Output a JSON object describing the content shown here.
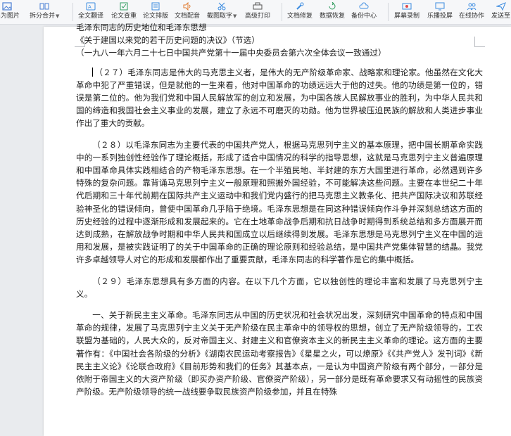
{
  "toolbar": {
    "items": [
      {
        "label": "出为图片"
      },
      {
        "label": "拆分合并"
      },
      {
        "label": "全文翻译"
      },
      {
        "label": "论文查重"
      },
      {
        "label": "论文排版"
      },
      {
        "label": "文档配音"
      },
      {
        "label": "截图取字"
      },
      {
        "label": "高级打印"
      },
      {
        "label": "文档修复"
      },
      {
        "label": "数据恢复"
      },
      {
        "label": "备份中心"
      },
      {
        "label": "屏幕录制"
      },
      {
        "label": "乐播投屏"
      },
      {
        "label": "在线协作"
      },
      {
        "label": "发送至"
      }
    ]
  },
  "document": {
    "title_line1": "毛泽东同志的历史地位和毛泽东思想",
    "title_line2": "《关于建国以来党的若干历史问题的决议》（节选）",
    "title_line3": "（一九八一年六月二十七日中国共产党第十一届中央委员会第六次全体会议一致通过）",
    "para27": "（２７）毛泽东同志是伟大的马克思主义者，是伟大的无产阶级革命家、战略家和理论家。他虽然在文化大革命中犯了严重错误，但是就他的一生来看，他对中国革命的功绩远远大于他的过失。他的功绩是第一位的，错误是第二位的。他为我们党和中国人民解放军的创立和发展，为中国各族人民解放事业的胜利，为中华人民共和国的缔造和我国社会主义事业的发展，建立了永远不可磨灭的功勋。他为世界被压迫民族的解放和人类进步事业作出了重大的贡献。",
    "para28": "（２８）以毛泽东同志为主要代表的中国共产党人，根据马克思列宁主义的基本原理，把中国长期革命实践中的一系列独创性经验作了理论概括，形成了适合中国情况的科学的指导思想，这就是马克思列宁主义普遍原理和中国革命具体实践相结合的产物毛泽东思想。在一个半殖民地、半封建的东方大国里进行革命，必然遇到许多特殊的复杂问题。靠背诵马克思列宁主义一般原理和照搬外国经验，不可能解决这些问题。主要在本世纪二十年代后期和三十年代前期在国际共产主义运动中和我们党内盛行的把马克思主义教条化、把共产国际决议和苏联经验神圣化的错误倾向，曾使中国革命几乎陷于绝境。毛泽东思想是在同这种错误倾向作斗争并深刻总结这方面的历史经验的过程中逐渐形成和发展起来的。它在土地革命战争后期和抗日战争时期得到系统总结和多方面展开而达到成熟，在解放战争时期和中华人民共和国成立以后继续得到发展。毛泽东思想是马克思列宁主义在中国的运用和发展，是被实践证明了的关于中国革命的正确的理论原则和经验总结，是中国共产党集体智慧的结晶。我党许多卓越领导人对它的形成和发展都作出了重要贡献，毛泽东同志的科学著作是它的集中概括。",
    "para29": "（２９）毛泽东思想具有多方面的内容。在以下几个方面，它以独创性的理论丰富和发展了马克思列宁主义。",
    "para30": "一、关于新民主主义革命。毛泽东同志从中国的历史状况和社会状况出发，深刻研究中国革命的特点和中国革命的规律，发展了马克思列宁主义关于无产阶级在民主革命中的领导权的思想，创立了无产阶级领导的，工农联盟为基础的，人民大众的，反对帝国主义、封建主义和官僚资本主义的新民主主义革命的理论。这方面的主要著作有：《中国社会各阶级的分析》《湖南农民运动考察报告》《星星之火，可以燎原》《《共产党人》发刊词》《新民主主义论》《论联合政府》《目前形势和我们的任务》其基本点，一是认为中国资产阶级有两个部分，一部分是依附于帝国主义的大资产阶级（即买办资产阶级、官僚资产阶级），另一部分是既有革命要求又有动摇性的民族资产阶级。无产阶级领导的统一战线要争取民族资产阶级参加，并且在特殊"
  }
}
